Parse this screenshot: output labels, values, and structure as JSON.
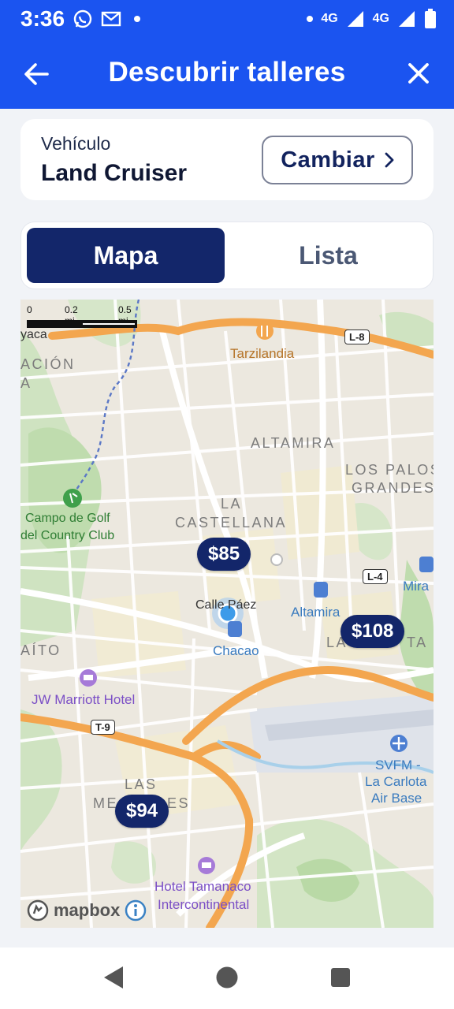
{
  "status_bar": {
    "time": "3:36",
    "network_1": "4G",
    "network_2": "4G",
    "icons": [
      "whatsapp-icon",
      "gmail-icon",
      "notification-dot",
      "signal-icon",
      "battery-icon"
    ]
  },
  "app_bar": {
    "title": "Descubrir talleres",
    "back_icon": "arrow-left-icon",
    "close_icon": "close-icon",
    "color": "#1b54f0"
  },
  "vehicle": {
    "label": "Vehículo",
    "name": "Land Cruiser",
    "change_label": "Cambiar"
  },
  "view_toggle": {
    "map_label": "Mapa",
    "list_label": "Lista",
    "selected": "Mapa",
    "selected_color": "#13266a"
  },
  "map": {
    "scale": {
      "zero": "0",
      "mid": "0.2 mi",
      "end": "0.5 mi"
    },
    "areas": {
      "altamira": "ALTAMIRA",
      "los_palos_1": "LOS PALOS",
      "los_palos_2": "GRANDES",
      "la": "LA",
      "castellana": "CASTELLANA",
      "las": "LAS",
      "mercedes": "ME",
      "mercedes_end": "ES",
      "la_left": "LA",
      "la_end": "TA",
      "cion": "ACIÓN",
      "aito": "AÍTO",
      "yaca": "yaca",
      "a": "A"
    },
    "pois": {
      "tarzilandia": "Tarzilandia",
      "golf_1": "Campo de Golf",
      "golf_2": "del Country Club",
      "jw_marriott": "JW Marriott Hotel",
      "chacao": "Chacao",
      "altamira_station": "Altamira",
      "mira": "Mira",
      "calle_paez": "Calle Páez",
      "svfm_1": "SVFM -",
      "svfm_2": "La Carlota",
      "svfm_3": "Air Base",
      "tamanaco_1": "Hotel Tamanaco",
      "tamanaco_2": "Intercontinental"
    },
    "road_shields": {
      "l8": "L-8",
      "l4": "L-4",
      "t9": "T-9"
    },
    "prices": {
      "p1": "$85",
      "p2": "$108",
      "p3": "$94"
    },
    "attribution": "mapbox"
  },
  "nav_bar": {
    "back_icon": "triangle-back-icon",
    "home_icon": "circle-home-icon",
    "recents_icon": "square-recents-icon"
  }
}
